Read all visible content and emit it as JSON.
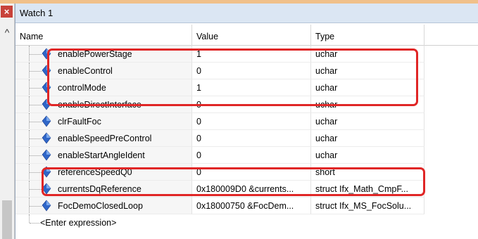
{
  "window": {
    "title": "Watch 1",
    "close_glyph": "×",
    "up_glyph": "^"
  },
  "columns": {
    "name": "Name",
    "value": "Value",
    "type": "Type"
  },
  "rows": [
    {
      "name": "enablePowerStage",
      "value": "1",
      "type": "uchar"
    },
    {
      "name": "enableControl",
      "value": "0",
      "type": "uchar"
    },
    {
      "name": "controlMode",
      "value": "1",
      "type": "uchar"
    },
    {
      "name": "enableDirectInterface",
      "value": "0",
      "type": "uchar"
    },
    {
      "name": "clrFaultFoc",
      "value": "0",
      "type": "uchar"
    },
    {
      "name": "enableSpeedPreControl",
      "value": "0",
      "type": "uchar"
    },
    {
      "name": "enableStartAngleIdent",
      "value": "0",
      "type": "uchar"
    },
    {
      "name": "referenceSpeedQ0",
      "value": "0",
      "type": "short"
    },
    {
      "name": "currentsDqReference",
      "value": "0x180009D0 &currents...",
      "type": "struct Ifx_Math_CmpF..."
    },
    {
      "name": "FocDemoClosedLoop",
      "value": "0x18000750 &FocDem...",
      "type": "struct Ifx_MS_FocSolu..."
    }
  ],
  "enter_expression": "<Enter expression>",
  "colors": {
    "highlight": "#e02626",
    "title_bar": "#dbe6f3",
    "icon_blue": "#2f66c8"
  },
  "icon": "variable-diamond-icon"
}
